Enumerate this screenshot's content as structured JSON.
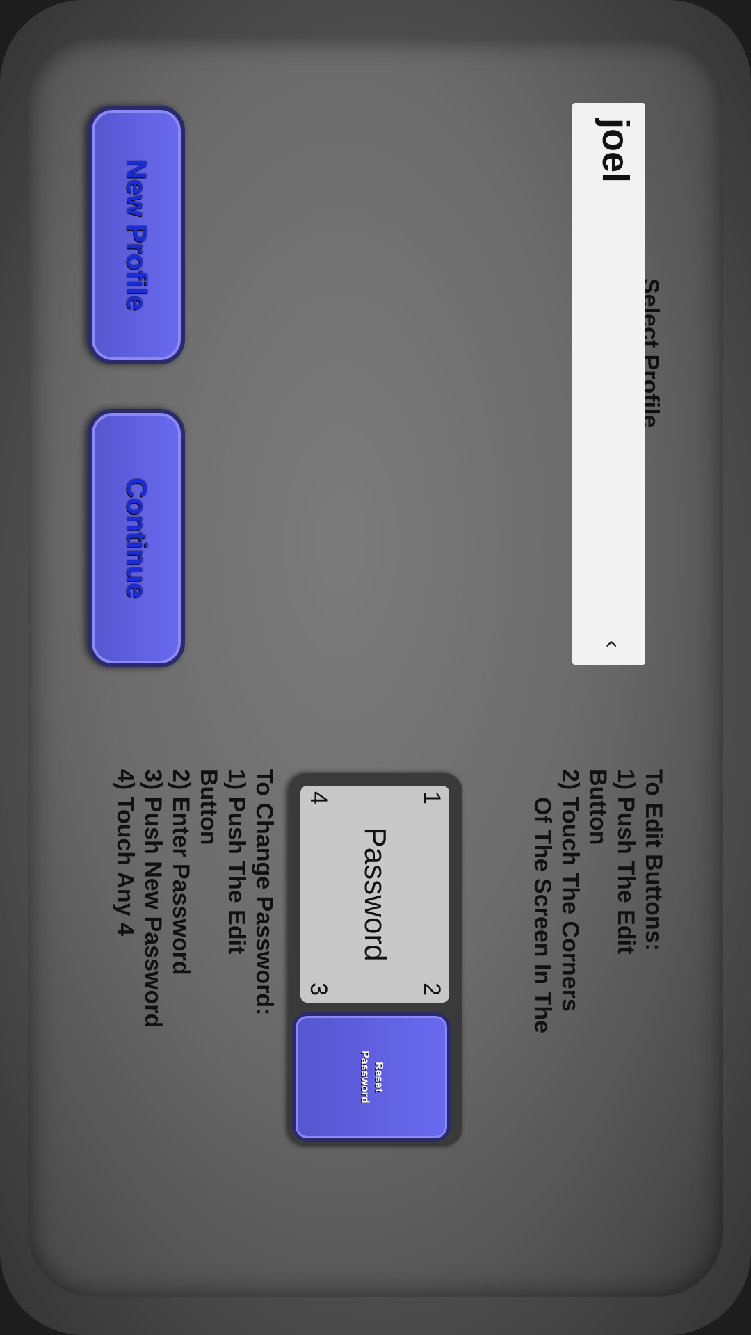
{
  "profile": {
    "title": "Select Profile",
    "selected": "joel",
    "chevron": "‹"
  },
  "buttons": {
    "new_profile": "New Profile",
    "continue": "Continue"
  },
  "edit_help": {
    "heading": "To Edit Buttons:",
    "line1": "1) Push The Edit",
    "line2": "Button",
    "line3": "2) Touch The Corners",
    "line4": "Of The Screen In The"
  },
  "password_pad": {
    "c1": "1",
    "c2": "2",
    "c3": "3",
    "c4": "4",
    "label": "Password",
    "reset_line1": "Reset",
    "reset_line2": "Password"
  },
  "password_help": {
    "heading": "To Change Password:",
    "line1": "1) Push The Edit",
    "line2": "Button",
    "line3": "2) Enter Password",
    "line4": "3) Push New Password",
    "line5": "4) Touch Any 4"
  }
}
